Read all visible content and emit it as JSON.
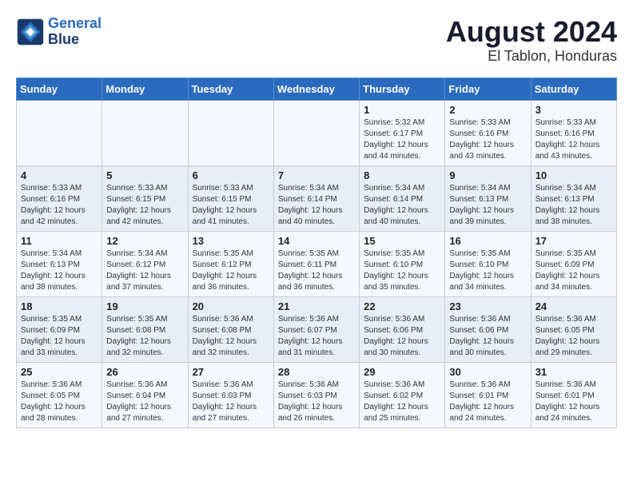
{
  "header": {
    "logo_line1": "General",
    "logo_line2": "Blue",
    "main_title": "August 2024",
    "subtitle": "El Tablon, Honduras"
  },
  "days_of_week": [
    "Sunday",
    "Monday",
    "Tuesday",
    "Wednesday",
    "Thursday",
    "Friday",
    "Saturday"
  ],
  "weeks": [
    {
      "days": [
        {
          "num": "",
          "info": ""
        },
        {
          "num": "",
          "info": ""
        },
        {
          "num": "",
          "info": ""
        },
        {
          "num": "",
          "info": ""
        },
        {
          "num": "1",
          "info": "Sunrise: 5:32 AM\nSunset: 6:17 PM\nDaylight: 12 hours\nand 44 minutes."
        },
        {
          "num": "2",
          "info": "Sunrise: 5:33 AM\nSunset: 6:16 PM\nDaylight: 12 hours\nand 43 minutes."
        },
        {
          "num": "3",
          "info": "Sunrise: 5:33 AM\nSunset: 6:16 PM\nDaylight: 12 hours\nand 43 minutes."
        }
      ]
    },
    {
      "days": [
        {
          "num": "4",
          "info": "Sunrise: 5:33 AM\nSunset: 6:16 PM\nDaylight: 12 hours\nand 42 minutes."
        },
        {
          "num": "5",
          "info": "Sunrise: 5:33 AM\nSunset: 6:15 PM\nDaylight: 12 hours\nand 42 minutes."
        },
        {
          "num": "6",
          "info": "Sunrise: 5:33 AM\nSunset: 6:15 PM\nDaylight: 12 hours\nand 41 minutes."
        },
        {
          "num": "7",
          "info": "Sunrise: 5:34 AM\nSunset: 6:14 PM\nDaylight: 12 hours\nand 40 minutes."
        },
        {
          "num": "8",
          "info": "Sunrise: 5:34 AM\nSunset: 6:14 PM\nDaylight: 12 hours\nand 40 minutes."
        },
        {
          "num": "9",
          "info": "Sunrise: 5:34 AM\nSunset: 6:13 PM\nDaylight: 12 hours\nand 39 minutes."
        },
        {
          "num": "10",
          "info": "Sunrise: 5:34 AM\nSunset: 6:13 PM\nDaylight: 12 hours\nand 38 minutes."
        }
      ]
    },
    {
      "days": [
        {
          "num": "11",
          "info": "Sunrise: 5:34 AM\nSunset: 6:13 PM\nDaylight: 12 hours\nand 38 minutes."
        },
        {
          "num": "12",
          "info": "Sunrise: 5:34 AM\nSunset: 6:12 PM\nDaylight: 12 hours\nand 37 minutes."
        },
        {
          "num": "13",
          "info": "Sunrise: 5:35 AM\nSunset: 6:12 PM\nDaylight: 12 hours\nand 36 minutes."
        },
        {
          "num": "14",
          "info": "Sunrise: 5:35 AM\nSunset: 6:11 PM\nDaylight: 12 hours\nand 36 minutes."
        },
        {
          "num": "15",
          "info": "Sunrise: 5:35 AM\nSunset: 6:10 PM\nDaylight: 12 hours\nand 35 minutes."
        },
        {
          "num": "16",
          "info": "Sunrise: 5:35 AM\nSunset: 6:10 PM\nDaylight: 12 hours\nand 34 minutes."
        },
        {
          "num": "17",
          "info": "Sunrise: 5:35 AM\nSunset: 6:09 PM\nDaylight: 12 hours\nand 34 minutes."
        }
      ]
    },
    {
      "days": [
        {
          "num": "18",
          "info": "Sunrise: 5:35 AM\nSunset: 6:09 PM\nDaylight: 12 hours\nand 33 minutes."
        },
        {
          "num": "19",
          "info": "Sunrise: 5:35 AM\nSunset: 6:08 PM\nDaylight: 12 hours\nand 32 minutes."
        },
        {
          "num": "20",
          "info": "Sunrise: 5:36 AM\nSunset: 6:08 PM\nDaylight: 12 hours\nand 32 minutes."
        },
        {
          "num": "21",
          "info": "Sunrise: 5:36 AM\nSunset: 6:07 PM\nDaylight: 12 hours\nand 31 minutes."
        },
        {
          "num": "22",
          "info": "Sunrise: 5:36 AM\nSunset: 6:06 PM\nDaylight: 12 hours\nand 30 minutes."
        },
        {
          "num": "23",
          "info": "Sunrise: 5:36 AM\nSunset: 6:06 PM\nDaylight: 12 hours\nand 30 minutes."
        },
        {
          "num": "24",
          "info": "Sunrise: 5:36 AM\nSunset: 6:05 PM\nDaylight: 12 hours\nand 29 minutes."
        }
      ]
    },
    {
      "days": [
        {
          "num": "25",
          "info": "Sunrise: 5:36 AM\nSunset: 6:05 PM\nDaylight: 12 hours\nand 28 minutes."
        },
        {
          "num": "26",
          "info": "Sunrise: 5:36 AM\nSunset: 6:04 PM\nDaylight: 12 hours\nand 27 minutes."
        },
        {
          "num": "27",
          "info": "Sunrise: 5:36 AM\nSunset: 6:03 PM\nDaylight: 12 hours\nand 27 minutes."
        },
        {
          "num": "28",
          "info": "Sunrise: 5:36 AM\nSunset: 6:03 PM\nDaylight: 12 hours\nand 26 minutes."
        },
        {
          "num": "29",
          "info": "Sunrise: 5:36 AM\nSunset: 6:02 PM\nDaylight: 12 hours\nand 25 minutes."
        },
        {
          "num": "30",
          "info": "Sunrise: 5:36 AM\nSunset: 6:01 PM\nDaylight: 12 hours\nand 24 minutes."
        },
        {
          "num": "31",
          "info": "Sunrise: 5:36 AM\nSunset: 6:01 PM\nDaylight: 12 hours\nand 24 minutes."
        }
      ]
    }
  ]
}
